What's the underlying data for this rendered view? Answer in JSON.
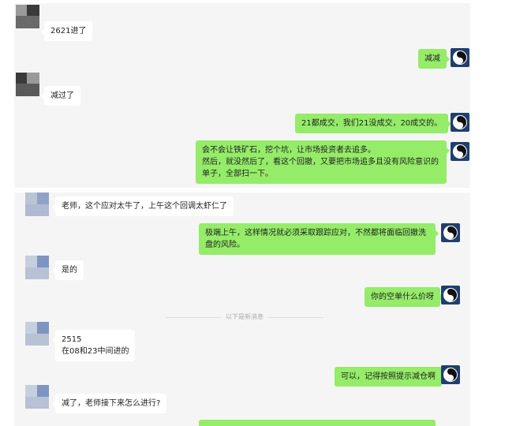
{
  "colors": {
    "sent_bubble": "#95ec69",
    "received_bubble": "#ffffff",
    "panel_bg": "#f5f5f5"
  },
  "icons": {
    "sender_avatar": "blurred-avatar-icon",
    "self_avatar": "yin-yang-icon"
  },
  "messages": [
    {
      "side": "received",
      "text": "2621进了"
    },
    {
      "side": "sent",
      "text": "减减"
    },
    {
      "side": "received",
      "text": "减过了"
    },
    {
      "side": "sent",
      "text": "21都成交，我们21没成交，20成交的。"
    },
    {
      "side": "sent",
      "text": "会不会让铁矿石，挖个坑，让市场投资者去追多。\n然后，就没然后了，看这个回撤，又要把市场追多且没有风险意识的单子，全部扫一下。"
    },
    {
      "side": "received",
      "text": "老师，这个应对太牛了，上午这个回调太虾仁了"
    },
    {
      "side": "sent",
      "text": "极端上午，这样情况就必须采取跟踪应对，不然都将面临回撤洗盘的风险。"
    },
    {
      "side": "received",
      "text": "是的"
    },
    {
      "side": "sent",
      "text": "你的空单什么价呀"
    },
    {
      "side": "received",
      "text": "2515\n在08和23中间进的"
    },
    {
      "side": "sent",
      "text": "可以，记得按照提示减仓啊"
    },
    {
      "side": "received",
      "text": "减了，老师接下来怎么进行?"
    }
  ],
  "divider": {
    "text": "以下是新消息"
  }
}
